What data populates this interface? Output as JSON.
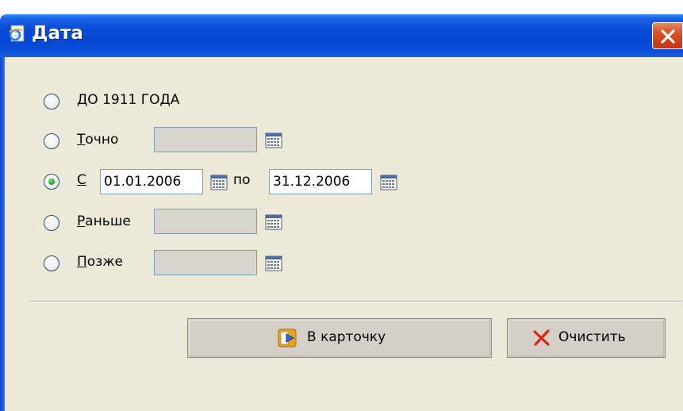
{
  "window": {
    "title": "Дата",
    "title_icon": "ie-document-icon",
    "close_icon": "close-icon"
  },
  "options": [
    {
      "id": "before1911",
      "label": "ДО 1911 ГОДА",
      "selected": false
    },
    {
      "id": "exact",
      "label_mnemonic": "Т",
      "label_rest": "очно",
      "value": "",
      "selected": false
    },
    {
      "id": "range",
      "label_mnemonic": "С",
      "label_rest": "",
      "from_value": "01.01.2006",
      "to_label": "по",
      "to_value": "31.12.2006",
      "selected": true
    },
    {
      "id": "earlier",
      "label_mnemonic": "Р",
      "label_rest": "аньше",
      "value": "",
      "selected": false
    },
    {
      "id": "later",
      "label_mnemonic": "П",
      "label_rest": "озже",
      "value": "",
      "selected": false
    }
  ],
  "buttons": {
    "to_card": {
      "label": "В карточку",
      "icon": "to-card-icon"
    },
    "clear": {
      "label": "Очистить",
      "icon": "red-x-icon"
    }
  },
  "colors": {
    "titlebar": "#0a4bd6",
    "client_bg": "#ece9d8",
    "selected_radio": "#2ea42e",
    "clear_icon": "#e02010"
  }
}
